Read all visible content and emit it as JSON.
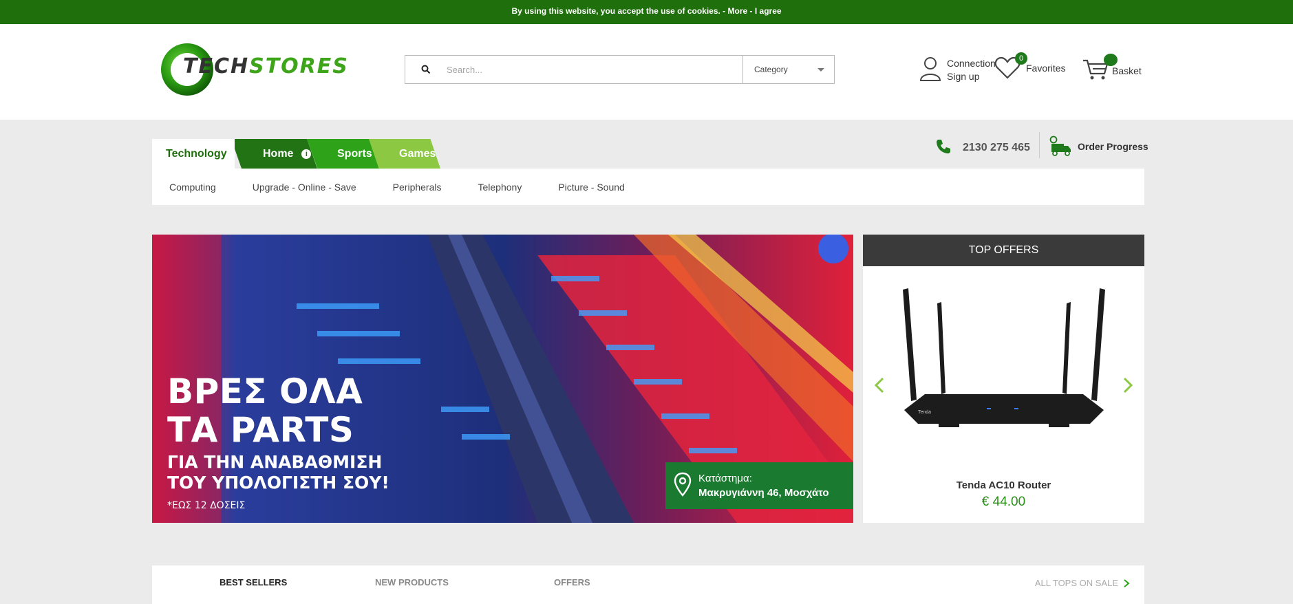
{
  "cookie": {
    "text": "By using this website, you accept the use of cookies. - ",
    "more": "More",
    "sep": " - ",
    "agree": "I agree"
  },
  "header": {
    "logo_text_a": "TECH",
    "logo_text_b": "STORES",
    "search_placeholder": "Search...",
    "category_label": "Category",
    "account_line1": "Connection",
    "account_line2": "Sign up",
    "favorites_count": "0",
    "favorites_label": "Favorites",
    "basket_label": "Basket"
  },
  "nav": {
    "tabs": [
      {
        "label": "Technology"
      },
      {
        "label": "Home"
      },
      {
        "label": "Sports"
      },
      {
        "label": "Games"
      }
    ],
    "phone": "2130 275 465",
    "order_progress": "Order Progress",
    "subnav": [
      "Computing",
      "Upgrade - Online - Save",
      "Peripherals",
      "Telephony",
      "Picture - Sound"
    ]
  },
  "banner": {
    "line1": "ΒΡΕΣ ΟΛΑ",
    "line2": "ΤΑ PARTS",
    "line3": "ΓΙΑ ΤΗΝ ΑΝΑΒΑΘΜΙΣΗ",
    "line4": "ΤΟΥ ΥΠΟΛΟΓΙΣΤΗ ΣΟΥ!",
    "line5": "*ΕΩΣ 12 ΔΟΣΕΙΣ",
    "store_label": "Κατάστημα:",
    "store_address": "Μακρυγιάννη 46, Μοσχάτο"
  },
  "top_offers": {
    "title": "TOP OFFERS",
    "product_name": "Tenda AC10 Router",
    "price": "€ 44.00",
    "router_brand": "Tenda"
  },
  "product_tabs": {
    "tabs": [
      "BEST SELLERS",
      "NEW PRODUCTS",
      "OFFERS"
    ],
    "all_tops": "ALL TOPS ON SALE"
  },
  "colors": {
    "brand_green": "#1f6f0c",
    "accent_green": "#2ea319",
    "light_green": "#8cc842",
    "price_green": "#2b8f1a"
  }
}
